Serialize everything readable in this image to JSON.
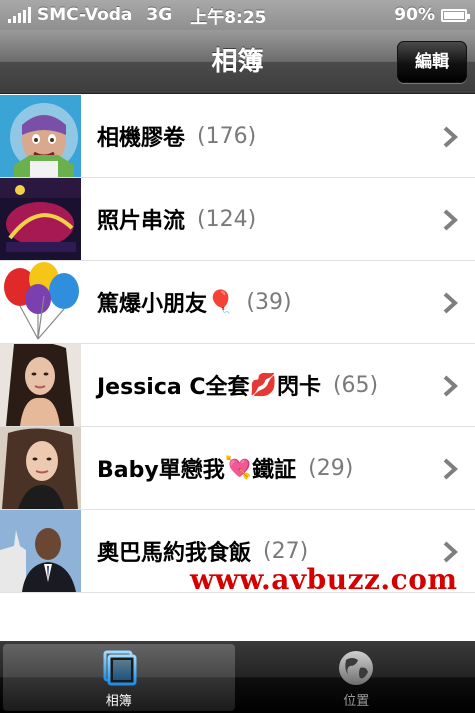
{
  "status_bar": {
    "carrier": "SMC-Voda",
    "network": "3G",
    "time": "上午8:25",
    "battery": "90%",
    "battery_level": 0.9
  },
  "nav": {
    "title": "相簿",
    "edit_label": "編輯"
  },
  "albums": [
    {
      "name": "相機膠卷",
      "count": "(176)",
      "thumb": "toy-space-ranger"
    },
    {
      "name": "照片串流",
      "count": "(124)",
      "thumb": "airplay-poster"
    },
    {
      "name": "篤爆小朋友",
      "emoji": "🎈",
      "count": "(39)",
      "thumb": "balloons"
    },
    {
      "name": "Jessica C全套",
      "emoji": "💋",
      "name_after": "閃卡",
      "count": "(65)",
      "thumb": "portrait-woman-1"
    },
    {
      "name": "Baby單戀我",
      "emoji": "💘",
      "name_after": "鐵証",
      "count": "(29)",
      "thumb": "portrait-woman-2"
    },
    {
      "name": "奧巴馬約我食飯",
      "count": "(27)",
      "thumb": "portrait-man-suit"
    }
  ],
  "watermark": "www.avbuzz.com",
  "tabs": [
    {
      "label": "相簿",
      "icon": "albums-icon",
      "active": true
    },
    {
      "label": "位置",
      "icon": "globe-icon",
      "active": false
    }
  ],
  "colors": {
    "watermark": "#d50000",
    "count_text": "#7a7a7a",
    "chevron": "#7f7f7f"
  }
}
